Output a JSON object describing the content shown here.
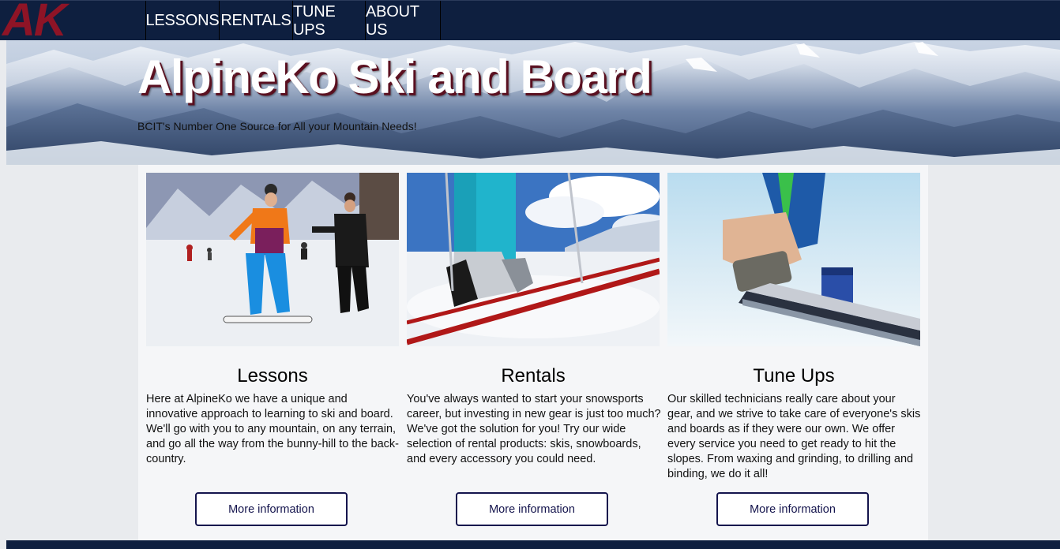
{
  "logo": {
    "text": "AK",
    "color": "#8e1426"
  },
  "nav": {
    "items": [
      {
        "label": "LESSONS"
      },
      {
        "label": "RENTALS"
      },
      {
        "label": "TUNE UPS"
      },
      {
        "label": "ABOUT US"
      }
    ]
  },
  "hero": {
    "title": "AlpineKo Ski and Board",
    "subtitle": "BCIT's Number One Source for All your Mountain Needs!"
  },
  "cards": [
    {
      "image": "snowboard-lesson-photo",
      "title": "Lessons",
      "text": "Here at AlpineKo we have a unique and innovative approach to learning to ski and board. We'll go with you to any mountain, on any terrain, and go all the way from the bunny-hill to the back-country.",
      "button": "More information"
    },
    {
      "image": "ski-boots-photo",
      "title": "Rentals",
      "text": "You've always wanted to start your snowsports career, but investing in new gear is just too much? We've got the solution for you! Try our wide selection of rental products: skis, snowboards, and every accessory you could need.",
      "button": "More information"
    },
    {
      "image": "ski-waxing-photo",
      "title": "Tune Ups",
      "text": "Our skilled technicians really care about your gear, and we strive to take care of everyone's skis and boards as if they were our own. We offer every service you need to get ready to hit the slopes. From waxing and grinding, to drilling and binding, we do it all!",
      "button": "More information"
    }
  ],
  "colors": {
    "navbar": "#0e1f3f",
    "panel": "#f5f6f8",
    "page": "#e9ebee",
    "button_border": "#14144d"
  }
}
